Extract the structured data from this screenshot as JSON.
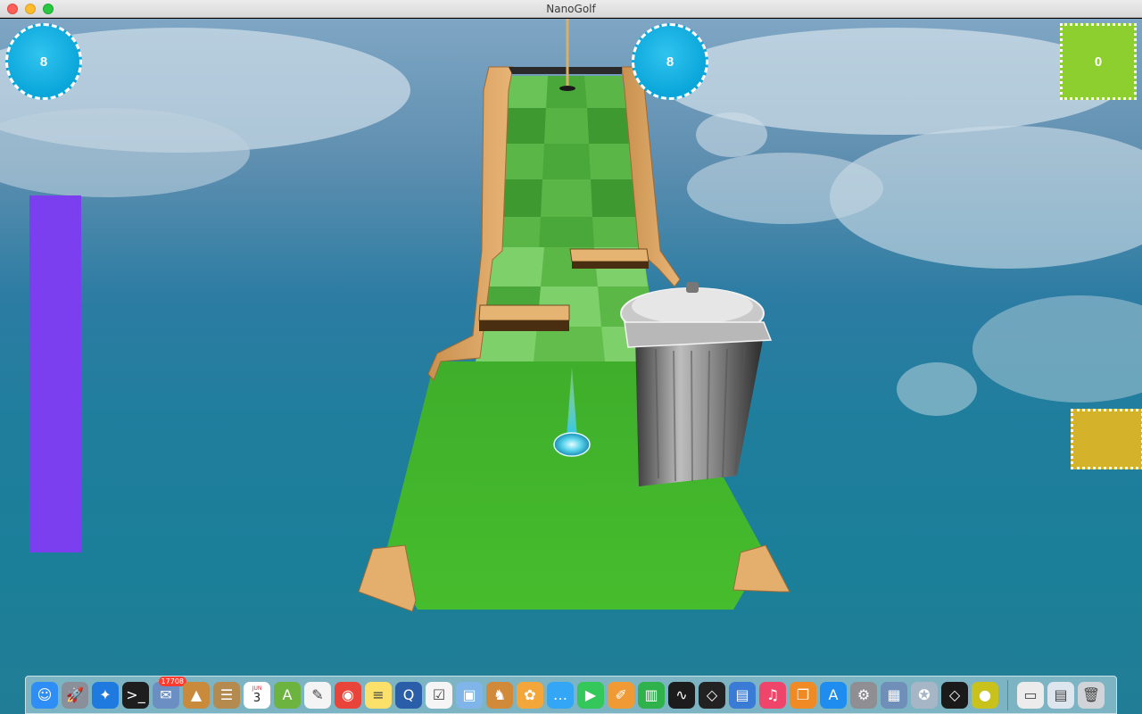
{
  "window": {
    "title": "NanoGolf"
  },
  "hud": {
    "left_counter": "8",
    "center_counter": "8",
    "score": "0",
    "colors": {
      "counter_bg": "#0aa6da",
      "score_bg": "#8ccf2e",
      "side_button_bg": "#d4b32a",
      "power_bar": "#7b3ff0"
    }
  },
  "dock": {
    "badge_mail": "17708",
    "calendar_day": "3",
    "calendar_month": "JUN",
    "icons": [
      {
        "name": "finder-icon",
        "color": "#2f8ef5",
        "glyph": "☺"
      },
      {
        "name": "launchpad-icon",
        "color": "#8a8f99",
        "glyph": "🚀"
      },
      {
        "name": "safari-icon",
        "color": "#1f7ae0",
        "glyph": "✦"
      },
      {
        "name": "terminal-icon",
        "color": "#1e1e1e",
        "glyph": ">_"
      },
      {
        "name": "mail-stamp-icon",
        "color": "#6b8fc2",
        "glyph": "✉"
      },
      {
        "name": "app-icon-1",
        "color": "#c98a3b",
        "glyph": "▲"
      },
      {
        "name": "contacts-icon",
        "color": "#b58a4f",
        "glyph": "☰"
      },
      {
        "name": "calendar-icon",
        "color": "#ffffff",
        "glyph": ""
      },
      {
        "name": "android-studio-icon",
        "color": "#6db33f",
        "glyph": "A"
      },
      {
        "name": "textedit-icon",
        "color": "#f4f4f4",
        "glyph": "✎"
      },
      {
        "name": "chrome-icon",
        "color": "#e9443a",
        "glyph": "◉"
      },
      {
        "name": "notes-icon",
        "color": "#fbe16a",
        "glyph": "≡"
      },
      {
        "name": "quicktime-icon",
        "color": "#2a5ea8",
        "glyph": "Q"
      },
      {
        "name": "reminders-icon",
        "color": "#f5f5f5",
        "glyph": "☑"
      },
      {
        "name": "preview-icon",
        "color": "#7fb5e8",
        "glyph": "▣"
      },
      {
        "name": "app-icon-2",
        "color": "#d08a3a",
        "glyph": "♞"
      },
      {
        "name": "photos-icon",
        "color": "#f3a63a",
        "glyph": "✿"
      },
      {
        "name": "messages-icon",
        "color": "#33a7f5",
        "glyph": "…"
      },
      {
        "name": "facetime-icon",
        "color": "#34c759",
        "glyph": "▶"
      },
      {
        "name": "pages-icon",
        "color": "#f09a36",
        "glyph": "✐"
      },
      {
        "name": "numbers-icon",
        "color": "#2fb24c",
        "glyph": "▥"
      },
      {
        "name": "activity-monitor-icon",
        "color": "#1c1c1c",
        "glyph": "∿"
      },
      {
        "name": "unity-icon",
        "color": "#222222",
        "glyph": "◇"
      },
      {
        "name": "keynote-icon",
        "color": "#3a7bd5",
        "glyph": "▤"
      },
      {
        "name": "itunes-icon",
        "color": "#f0456a",
        "glyph": "♫"
      },
      {
        "name": "ibooks-icon",
        "color": "#f08a24",
        "glyph": "❐"
      },
      {
        "name": "app-store-icon",
        "color": "#1f8cf0",
        "glyph": "A"
      },
      {
        "name": "system-preferences-icon",
        "color": "#8e8e93",
        "glyph": "⚙"
      },
      {
        "name": "image-capture-icon",
        "color": "#6f8fb8",
        "glyph": "▦"
      },
      {
        "name": "directory-utility-icon",
        "color": "#a6b6c6",
        "glyph": "✪"
      },
      {
        "name": "unity-hub-icon",
        "color": "#1a1a1a",
        "glyph": "◇"
      },
      {
        "name": "nanogolf-icon",
        "color": "#c9c21c",
        "glyph": "●"
      }
    ],
    "right_icons": [
      {
        "name": "downloads-stack-icon",
        "color": "#ececec",
        "glyph": "▭"
      },
      {
        "name": "documents-stack-icon",
        "color": "#dde6ee",
        "glyph": "▤"
      },
      {
        "name": "trash-icon",
        "color": "#d0d4d8",
        "glyph": "🗑"
      }
    ]
  }
}
